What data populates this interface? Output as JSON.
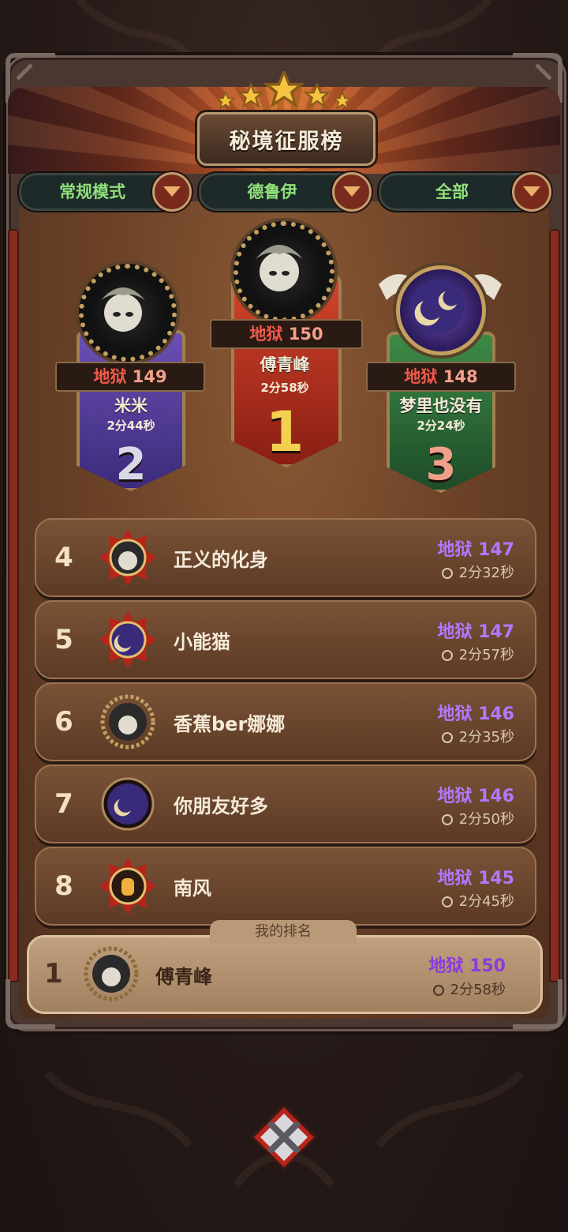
{
  "header": {
    "title": "秘境征服榜"
  },
  "filters": [
    {
      "label": "常规模式"
    },
    {
      "label": "德鲁伊"
    },
    {
      "label": "全部"
    }
  ],
  "podium": {
    "first": {
      "rank": "1",
      "level_prefix": "地狱",
      "level": "150",
      "name": "傅青峰",
      "time": "2分58秒"
    },
    "second": {
      "rank": "2",
      "level_prefix": "地狱",
      "level": "149",
      "name": "米米",
      "time": "2分44秒"
    },
    "third": {
      "rank": "3",
      "level_prefix": "地狱",
      "level": "148",
      "name": "梦里也没有",
      "time": "2分24秒"
    }
  },
  "list": [
    {
      "rank": "4",
      "name": "正义的化身",
      "level": "地狱 147",
      "time": "2分32秒"
    },
    {
      "rank": "5",
      "name": "小能猫",
      "level": "地狱 147",
      "time": "2分57秒"
    },
    {
      "rank": "6",
      "name": "香蕉ber娜娜",
      "level": "地狱 146",
      "time": "2分35秒"
    },
    {
      "rank": "7",
      "name": "你朋友好多",
      "level": "地狱 146",
      "time": "2分50秒"
    },
    {
      "rank": "8",
      "name": "南风",
      "level": "地狱 145",
      "time": "2分45秒"
    }
  ],
  "my_rank": {
    "label": "我的排名",
    "rank": "1",
    "name": "傅青峰",
    "level": "地狱 150",
    "time": "2分58秒"
  },
  "icons": {
    "close": "close-x-icon",
    "clock": "clock-icon",
    "dropdown": "chevron-down-icon"
  },
  "colors": {
    "level_purple": "#b078ff",
    "level_red": "#f05a4a",
    "filter_green": "#8fe07a"
  }
}
